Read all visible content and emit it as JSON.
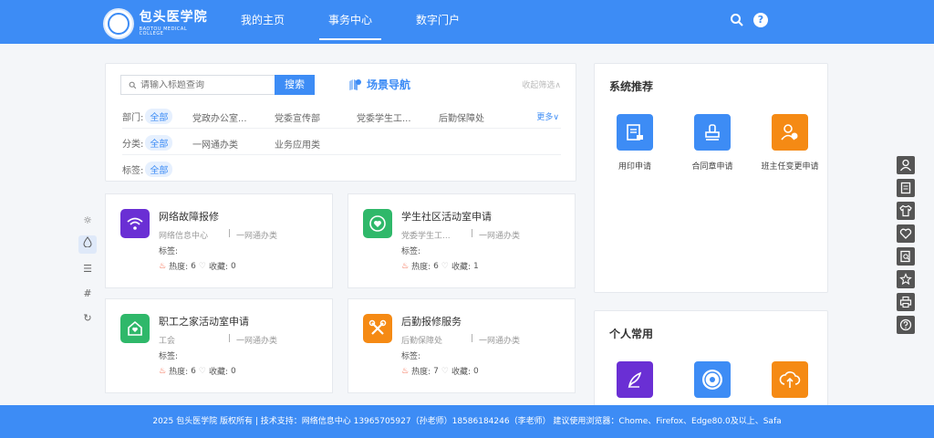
{
  "header": {
    "logo_cn": "包头医学院",
    "logo_en": "BAOTOU MEDICAL COLLEGE",
    "nav": [
      "我的主页",
      "事务中心",
      "数字门户"
    ],
    "active_nav": "事务中心",
    "brand_color": "#3d8cf5",
    "icons": [
      "search-icon",
      "help-icon"
    ],
    "help_glyph": "?"
  },
  "search": {
    "placeholder": "请输入标题查询",
    "button_label": "搜索",
    "scene_nav_label": "场景导航",
    "collapse_label": "收起筛选"
  },
  "filters": {
    "dept_label": "部门:",
    "dept_all": "全部",
    "dept_items": [
      "党政办公室...",
      "党委宣传部",
      "党委学生工...",
      "后勤保障处"
    ],
    "more_label": "更多",
    "category_label": "分类:",
    "category_all": "全部",
    "category_items": [
      "一网通办类",
      "业务应用类"
    ],
    "tag_label": "标签:",
    "tag_all": "全部"
  },
  "cards": [
    {
      "title": "网络故障报修",
      "dept": "网络信息中心",
      "category": "一网通办类",
      "tags_label": "标签:",
      "heat_label": "热度:",
      "heat": "6",
      "fav_label": "收藏:",
      "fav": "0",
      "color": "#6a2fd4",
      "icon": "wifi-icon"
    },
    {
      "title": "学生社区活动室申请",
      "dept": "党委学生工...",
      "category": "一网通办类",
      "tags_label": "标签:",
      "heat_label": "热度:",
      "heat": "6",
      "fav_label": "收藏:",
      "fav": "1",
      "color": "#2fb86a",
      "icon": "chat-heart-icon"
    },
    {
      "title": "职工之家活动室申请",
      "dept": "工会",
      "category": "一网通办类",
      "tags_label": "标签:",
      "heat_label": "热度:",
      "heat": "6",
      "fav_label": "收藏:",
      "fav": "0",
      "color": "#2fb86a",
      "icon": "home-heart-icon"
    },
    {
      "title": "后勤报修服务",
      "dept": "后勤保障处",
      "category": "一网通办类",
      "tags_label": "标签:",
      "heat_label": "热度:",
      "heat": "7",
      "fav_label": "收藏:",
      "fav": "0",
      "color": "#f58a14",
      "icon": "tools-icon"
    }
  ],
  "card_separator": "|",
  "recommend": {
    "title": "系统推荐",
    "apps": [
      {
        "label": "用印申请",
        "color": "#3d8cf5",
        "icon": "document-stamp-icon"
      },
      {
        "label": "合同章申请",
        "color": "#3d8cf5",
        "icon": "stamp-icon"
      },
      {
        "label": "班主任变更申请",
        "color": "#f58a14",
        "icon": "user-switch-icon"
      }
    ]
  },
  "personal": {
    "title": "个人常用",
    "apps": [
      {
        "label": "",
        "color": "#6a2fd4",
        "icon": "quill-icon"
      },
      {
        "label": "",
        "color": "#3d8cf5",
        "icon": "college-seal-icon"
      },
      {
        "label": "",
        "color": "#f58a14",
        "icon": "cloud-upload-icon"
      }
    ]
  },
  "left_toolbar": [
    "sun-icon",
    "drop-icon",
    "align-icon",
    "hash-icon",
    "refresh-icon"
  ],
  "right_toolbar": [
    "user-icon",
    "document-icon",
    "shirt-icon",
    "heart-icon",
    "search-doc-icon",
    "star-icon",
    "print-icon",
    "help-icon"
  ],
  "footer": {
    "text": "2025 包头医学院 版权所有 | 技术支持：网络信息中心 13965705927（孙老师）18586184246（李老师） 建议使用浏览器：Chome、Firefox、Edge80.0及以上、Safa"
  }
}
